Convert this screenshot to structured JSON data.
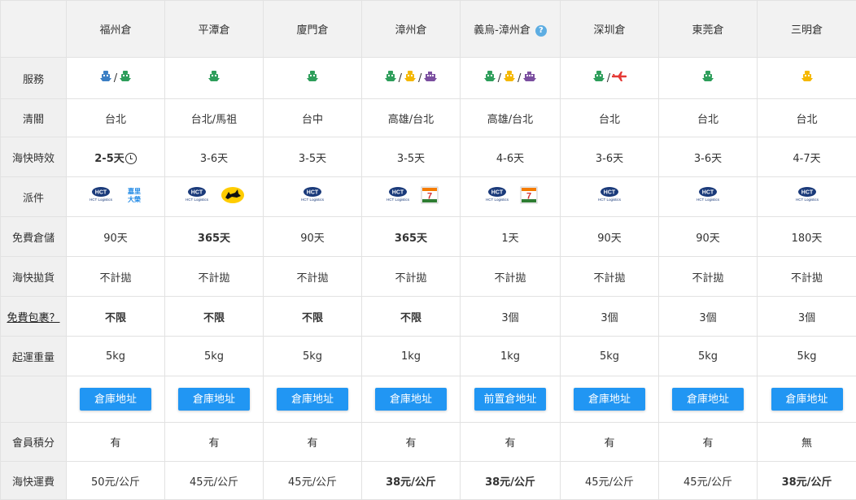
{
  "warehouses": [
    "福州倉",
    "平潭倉",
    "廈門倉",
    "漳州倉",
    "義烏-漳州倉",
    "深圳倉",
    "東莞倉",
    "三明倉"
  ],
  "help_glyph": "?",
  "rows": {
    "service": {
      "label": "服務",
      "icons": [
        [
          "ship-blue",
          "ship-green"
        ],
        [
          "ship-green"
        ],
        [
          "ship-green"
        ],
        [
          "ship-green",
          "ship-yellow",
          "ship-purple"
        ],
        [
          "ship-green",
          "ship-yellow",
          "ship-purple"
        ],
        [
          "ship-green",
          "plane-red"
        ],
        [
          "ship-green"
        ],
        [
          "ship-yellow"
        ]
      ]
    },
    "clearance": {
      "label": "清關",
      "values": [
        "台北",
        "台北/馬祖",
        "台中",
        "高雄/台北",
        "高雄/台北",
        "台北",
        "台北",
        "台北"
      ]
    },
    "eta": {
      "label": "海快時效",
      "values": [
        "2-5天",
        "3-6天",
        "3-5天",
        "3-5天",
        "4-6天",
        "3-6天",
        "3-6天",
        "4-7天"
      ]
    },
    "delivery": {
      "label": "派件",
      "hct_text": "HCT",
      "hct_caption": "HCT Logistics",
      "kerry_text": [
        "嘉里",
        "大榮"
      ],
      "seven_text": "7",
      "partners": [
        [
          "hct",
          "kerry"
        ],
        [
          "hct",
          "black-cat"
        ],
        [
          "hct"
        ],
        [
          "hct",
          "seven-eleven"
        ],
        [
          "hct",
          "seven-eleven"
        ],
        [
          "hct"
        ],
        [
          "hct"
        ],
        [
          "hct"
        ]
      ]
    },
    "storage": {
      "label": "免費倉儲",
      "values": [
        "90天",
        "365天",
        "90天",
        "365天",
        "1天",
        "90天",
        "90天",
        "180天"
      ]
    },
    "bulk": {
      "label": "海快拋貨",
      "values": [
        "不計拋",
        "不計拋",
        "不計拋",
        "不計拋",
        "不計拋",
        "不計拋",
        "不計拋",
        "不計拋"
      ]
    },
    "free_parcels": {
      "label": "免費包裹？",
      "values": [
        "不限",
        "不限",
        "不限",
        "不限",
        "3個",
        "3個",
        "3個",
        "3個"
      ]
    },
    "min_weight": {
      "label": "起運重量",
      "values": [
        "5kg",
        "5kg",
        "5kg",
        "1kg",
        "1kg",
        "5kg",
        "5kg",
        "5kg"
      ]
    },
    "address_buttons": {
      "label": "",
      "values": [
        "倉庫地址",
        "倉庫地址",
        "倉庫地址",
        "倉庫地址",
        "前置倉地址",
        "倉庫地址",
        "倉庫地址",
        "倉庫地址"
      ]
    },
    "points": {
      "label": "會員積分",
      "values": [
        "有",
        "有",
        "有",
        "有",
        "有",
        "有",
        "有",
        "無"
      ]
    },
    "fee": {
      "label": "海快運費",
      "values": [
        "50元/公斤",
        "45元/公斤",
        "45元/公斤",
        "38元/公斤",
        "38元/公斤",
        "45元/公斤",
        "45元/公斤",
        "38元/公斤"
      ]
    }
  },
  "bold_flags": {
    "eta": [
      true,
      false,
      false,
      false,
      false,
      false,
      false,
      false
    ],
    "storage": [
      false,
      true,
      false,
      true,
      false,
      false,
      false,
      false
    ],
    "free_parcels": [
      true,
      true,
      true,
      true,
      false,
      false,
      false,
      false
    ],
    "fee": [
      false,
      false,
      false,
      true,
      true,
      false,
      false,
      true
    ]
  },
  "colors": {
    "header_bg": "#f2f2f2",
    "button": "#2196f3",
    "ship_green": "#2e9e5b",
    "ship_yellow": "#f5b800",
    "ship_purple": "#7b4fa0",
    "ship_blue": "#3b7fc4",
    "plane_red": "#e53935",
    "seven_orange": "#f57c00",
    "seven_green": "#2e7d32",
    "seven_red": "#d32f2f",
    "hct_navy": "#1a3a7a",
    "kerry_blue": "#1e88e5",
    "blackcat_yellow": "#ffcc00"
  }
}
